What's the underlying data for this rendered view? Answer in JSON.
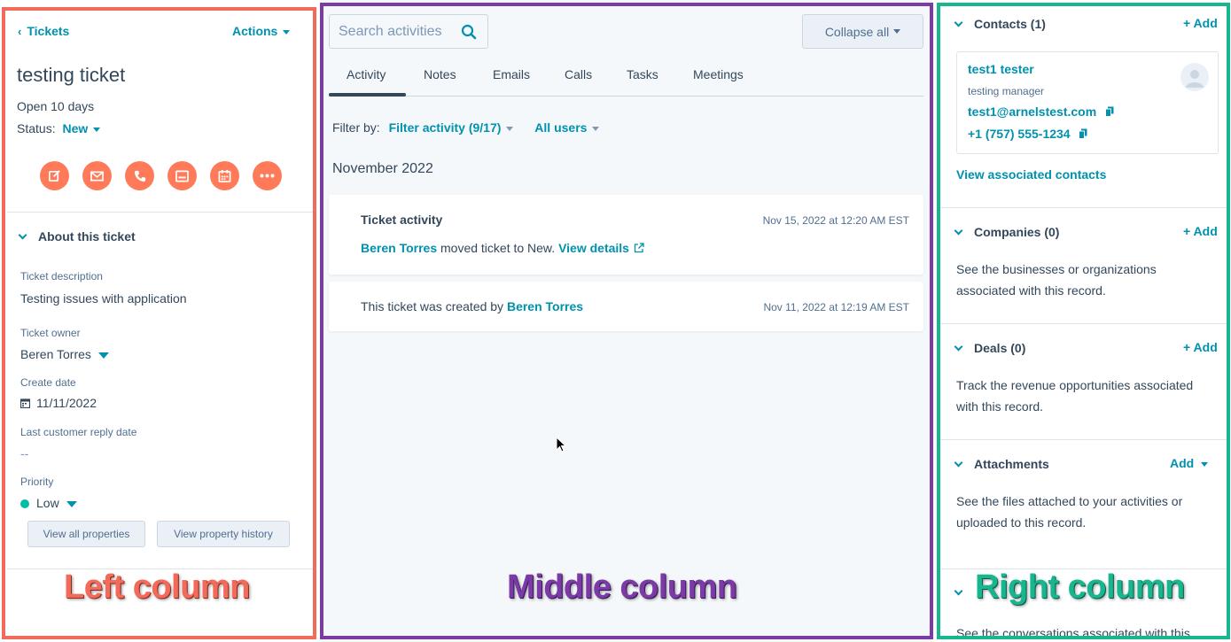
{
  "left": {
    "back_label": "Tickets",
    "actions_label": "Actions",
    "title": "testing ticket",
    "open_days": "Open 10 days",
    "status_label": "Status:",
    "status_value": "New",
    "action_icons": [
      "note-icon",
      "email-icon",
      "call-icon",
      "task-icon",
      "meeting-icon",
      "more-icon"
    ],
    "section_title": "About this ticket",
    "properties": {
      "description_label": "Ticket description",
      "description_value": "Testing issues with application",
      "owner_label": "Ticket owner",
      "owner_value": "Beren Torres",
      "create_date_label": "Create date",
      "create_date_value": "11/11/2022",
      "last_reply_label": "Last customer reply date",
      "last_reply_value": "--",
      "priority_label": "Priority",
      "priority_value": "Low"
    },
    "view_all_label": "View all properties",
    "view_history_label": "View property history",
    "accent": "#ff7a59"
  },
  "middle": {
    "search_placeholder": "Search activities",
    "collapse_label": "Collapse all",
    "tabs": [
      {
        "label": "Activity",
        "active": true
      },
      {
        "label": "Notes"
      },
      {
        "label": "Emails"
      },
      {
        "label": "Calls"
      },
      {
        "label": "Tasks"
      },
      {
        "label": "Meetings"
      }
    ],
    "filter_label": "Filter by:",
    "filter_activity": "Filter activity (9/17)",
    "filter_users": "All users",
    "month": "November 2022",
    "activities": [
      {
        "title": "Ticket activity",
        "time": "Nov 15, 2022 at 12:20 AM EST",
        "actor": "Beren Torres",
        "text": " moved ticket to New. ",
        "link": "View details"
      },
      {
        "prefix": "This ticket was created by ",
        "actor": "Beren Torres",
        "time": "Nov 11, 2022 at 12:19 AM EST"
      }
    ]
  },
  "right": {
    "contacts_title": "Contacts (1)",
    "add_label": "+ Add",
    "contact": {
      "name": "test1 tester",
      "job": "testing manager",
      "email": "test1@arnelstest.com",
      "phone": "+1 (757) 555-1234"
    },
    "view_contacts": "View associated contacts",
    "companies_title": "Companies (0)",
    "companies_text": "See the businesses or organizations associated with this record.",
    "deals_title": "Deals (0)",
    "deals_text": "Track the revenue opportunities associated with this record.",
    "attachments_title": "Attachments",
    "attachments_add": "Add",
    "attachments_text": "See the files attached to your activities or uploaded to this record.",
    "conversations_text": "See the conversations associated with this"
  },
  "labels": {
    "left": "Left column",
    "middle": "Middle column",
    "right": "Right column"
  },
  "colors": {
    "teal": "#0091ae",
    "frame_left": "#f26a5a",
    "frame_middle": "#7b3aa6",
    "frame_right": "#17b68f"
  }
}
